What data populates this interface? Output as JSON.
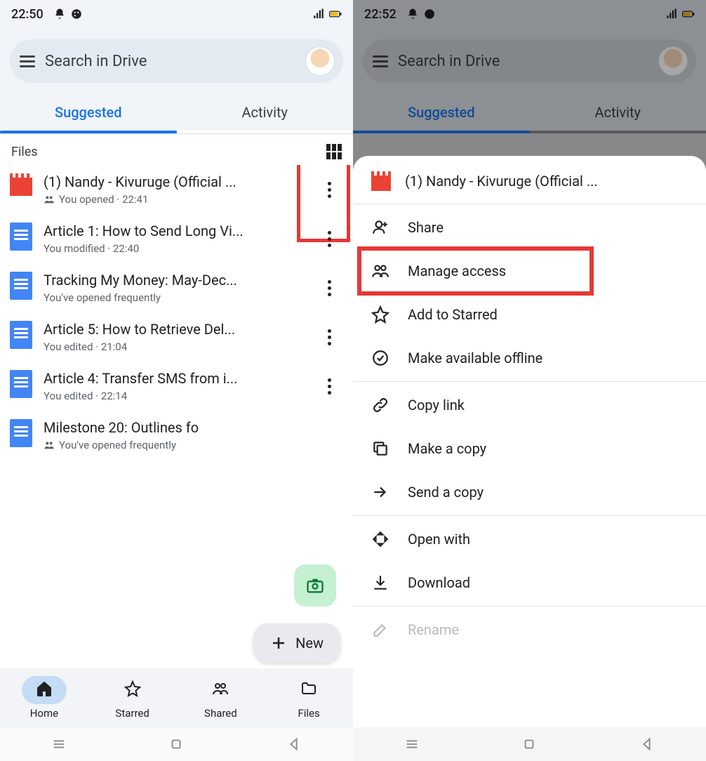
{
  "left": {
    "status": {
      "time": "22:50"
    },
    "search_placeholder": "Search in Drive",
    "tabs": {
      "suggested": "Suggested",
      "activity": "Activity"
    },
    "files_label": "Files",
    "files": [
      {
        "type": "video",
        "title": "(1) Nandy - Kivuruge (Official ...",
        "sub": "You opened · 22:41",
        "shared": true
      },
      {
        "type": "doc",
        "title": "Article 1: How to Send Long Vi...",
        "sub": "You modified · 22:40",
        "shared": false
      },
      {
        "type": "doc",
        "title": "Tracking My Money: May-Dec...",
        "sub": "You've opened frequently",
        "shared": false
      },
      {
        "type": "doc",
        "title": "Article 5: How to Retrieve Del...",
        "sub": "You edited · 21:04",
        "shared": false
      },
      {
        "type": "doc",
        "title": "Article 4: Transfer SMS from i...",
        "sub": "You edited · 22:14",
        "shared": false
      },
      {
        "type": "doc",
        "title": "Milestone 20: Outlines fo",
        "sub": "You've opened frequently",
        "shared": true
      }
    ],
    "fab_new": "New",
    "nav": {
      "home": "Home",
      "starred": "Starred",
      "shared": "Shared",
      "files": "Files"
    }
  },
  "right": {
    "status": {
      "time": "22:52"
    },
    "search_placeholder": "Search in Drive",
    "tabs": {
      "suggested": "Suggested",
      "activity": "Activity"
    },
    "sheet_title": "(1) Nandy - Kivuruge (Official ...",
    "actions": {
      "share": "Share",
      "manage_access": "Manage access",
      "add_starred": "Add to Starred",
      "offline": "Make available offline",
      "copy_link": "Copy link",
      "make_copy": "Make a copy",
      "send_copy": "Send a copy",
      "open_with": "Open with",
      "download": "Download",
      "rename": "Rename"
    }
  }
}
